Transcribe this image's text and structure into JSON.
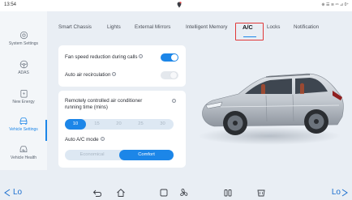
{
  "status": {
    "time": "13:54",
    "right_icons": "⊕ ☰ ≋ ⁴⁶ ⊿ 0⁺"
  },
  "sidebar": {
    "items": [
      {
        "label": "System Settings",
        "icon": "gear-icon"
      },
      {
        "label": "ADAS",
        "icon": "steering-wheel-icon"
      },
      {
        "label": "New Energy",
        "icon": "battery-icon"
      },
      {
        "label": "Vehicle Settings",
        "icon": "car-icon",
        "active": true
      },
      {
        "label": "Vehicle Health",
        "icon": "car-health-icon"
      }
    ]
  },
  "tabs": [
    {
      "label": "Smart Chassis"
    },
    {
      "label": "Lights"
    },
    {
      "label": "External Mirrors"
    },
    {
      "label": "Intelligent Memory"
    },
    {
      "label": "A/C",
      "active": true
    },
    {
      "label": "Locks"
    },
    {
      "label": "Notification"
    }
  ],
  "settings": {
    "fan_speed": {
      "label": "Fan speed reduction during calls",
      "info": "i",
      "enabled": true
    },
    "air_recirc": {
      "label": "Auto air recirculation",
      "info": "i",
      "enabled": false
    },
    "remote_ac": {
      "label_line1": "Remotely controlled air conditioner",
      "label_line2": "running time (mins)",
      "info": "i",
      "options": [
        "10",
        "15",
        "20",
        "25",
        "30"
      ],
      "selected": "10"
    },
    "auto_ac": {
      "label": "Auto A/C mode",
      "info": "i",
      "options": [
        "Economical",
        "Comfort"
      ],
      "selected": "Comfort"
    }
  },
  "bottom": {
    "temp_left": "Lo",
    "temp_right": "Lo"
  },
  "colors": {
    "accent": "#1c86e8",
    "highlight_box": "#e03838"
  }
}
